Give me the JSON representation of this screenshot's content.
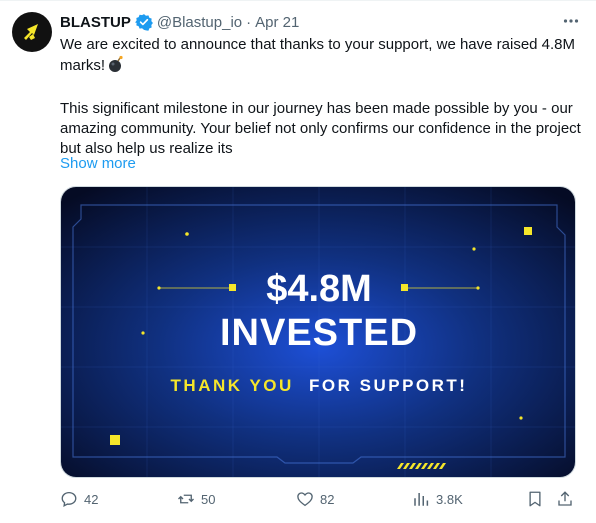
{
  "author": {
    "name": "BLASTUP",
    "handle": "@Blastup_io",
    "date": "Apr 21",
    "verified": true
  },
  "tweet": {
    "paragraph1": "We are excited to announce that thanks to your support, we have raised 4.8M marks!",
    "paragraph2": "This significant milestone in our journey has been made possible by you - our amazing community. Your belief not only confirms our confidence in the project but also help us realize its",
    "show_more": "Show more"
  },
  "media": {
    "headline_amount": "$4.8M",
    "headline_word": "INVESTED",
    "tagline_highlight": "THANK YOU",
    "tagline_rest": "FOR SUPPORT!"
  },
  "actions": {
    "replies": "42",
    "reposts": "50",
    "likes": "82",
    "views": "3.8K"
  },
  "colors": {
    "link": "#1d9bf0",
    "muted": "#536471",
    "accent_yellow": "#f5e62a",
    "media_bg": "#0b1f5c"
  },
  "icons": {
    "more": "more-horizontal-icon",
    "reply": "reply-icon",
    "repost": "repost-icon",
    "like": "heart-icon",
    "views": "views-chart-icon",
    "bookmark": "bookmark-icon",
    "share": "share-icon",
    "verified": "verified-badge-icon",
    "bomb": "bomb-emoji-icon",
    "avatar": "blastup-logo-icon"
  }
}
